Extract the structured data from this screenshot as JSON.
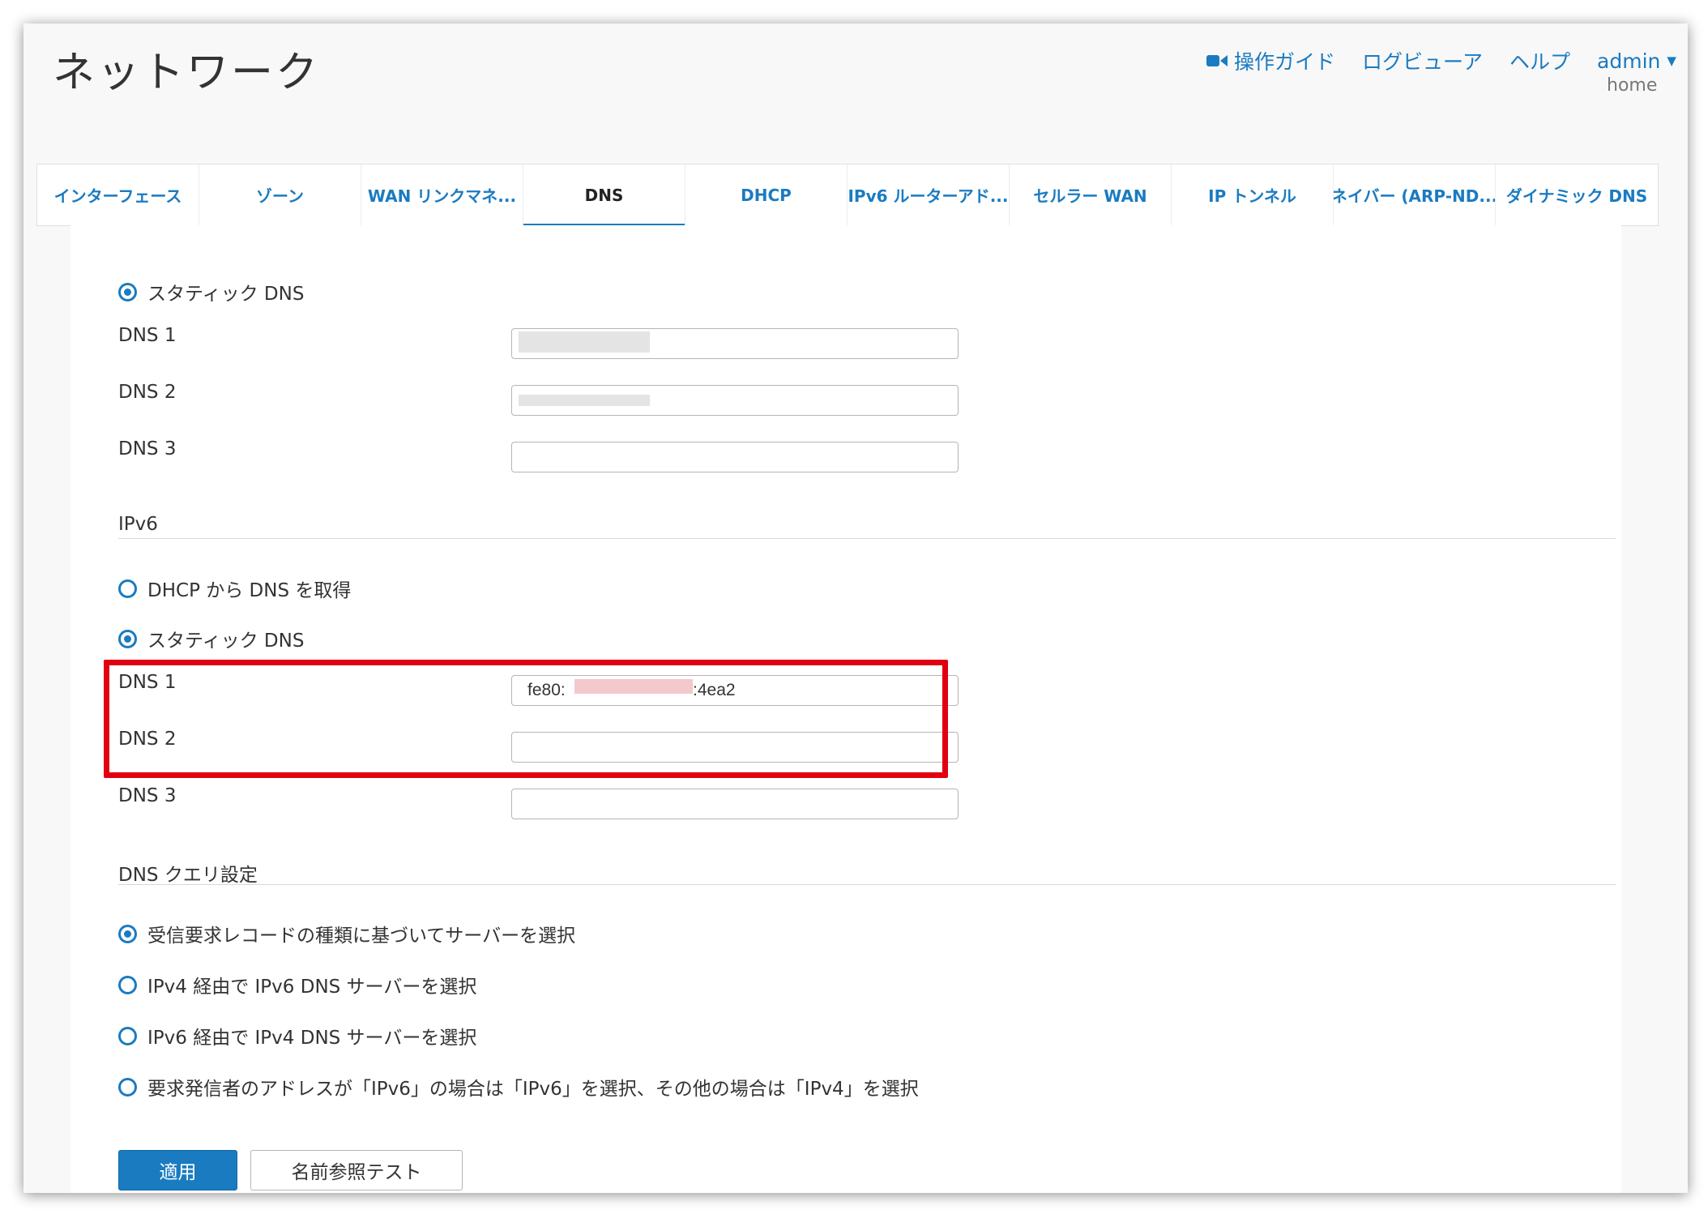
{
  "header": {
    "title": "ネットワーク",
    "links": {
      "guide": "操作ガイド",
      "log_viewer": "ログビューア",
      "help": "ヘルプ",
      "user": "admin",
      "user_sub": "home"
    }
  },
  "tabs": [
    {
      "label": "インターフェース"
    },
    {
      "label": "ゾーン"
    },
    {
      "label": "WAN リンクマネ..."
    },
    {
      "label": "DNS",
      "active": true
    },
    {
      "label": "DHCP"
    },
    {
      "label": "IPv6 ルーターアド..."
    },
    {
      "label": "セルラー WAN"
    },
    {
      "label": "IP トンネル"
    },
    {
      "label": "ネイバー (ARP-ND..."
    },
    {
      "label": "ダイナミック DNS"
    }
  ],
  "ipv4": {
    "static_label": "スタティック DNS",
    "static_checked": true,
    "fields": [
      {
        "label": "DNS 1",
        "value": ""
      },
      {
        "label": "DNS 2",
        "value": ""
      },
      {
        "label": "DNS 3",
        "value": ""
      }
    ]
  },
  "ipv6": {
    "heading": "IPv6",
    "dhcp_label": "DHCP から DNS を取得",
    "dhcp_checked": false,
    "static_label": "スタティック DNS",
    "static_checked": true,
    "fields": [
      {
        "label": "DNS 1",
        "value_start": "fe80:",
        "value_end": ":4ea2"
      },
      {
        "label": "DNS 2",
        "value": ""
      },
      {
        "label": "DNS 3",
        "value": ""
      }
    ]
  },
  "query": {
    "heading": "DNS クエリ設定",
    "options": [
      {
        "label": "受信要求レコードの種類に基づいてサーバーを選択",
        "checked": true
      },
      {
        "label": "IPv4 経由で IPv6 DNS サーバーを選択",
        "checked": false
      },
      {
        "label": "IPv6 経由で IPv4 DNS サーバーを選択",
        "checked": false
      },
      {
        "label": "要求発信者のアドレスが「IPv6」の場合は「IPv6」を選択、その他の場合は「IPv4」を選択",
        "checked": false
      }
    ]
  },
  "buttons": {
    "apply": "適用",
    "lookup": "名前参照テスト"
  },
  "colors": {
    "accent": "#1a7bc1",
    "highlight": "#e10010"
  }
}
